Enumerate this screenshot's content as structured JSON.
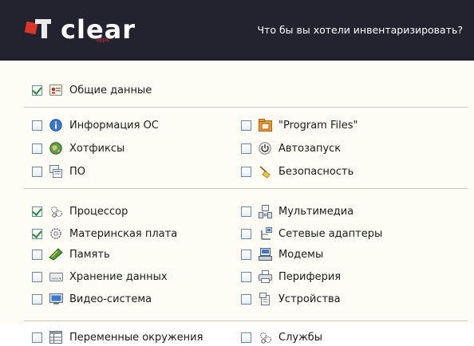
{
  "header": {
    "logo_text": "clear",
    "logo_sub": "apps",
    "question": "Что бы вы хотели инвентаризировать?"
  },
  "colors": {
    "header_bg": "#22232f",
    "accent_red": "#d8362b",
    "check_green": "#2f8a2f",
    "panel_bg": "#fdfdf6"
  },
  "groups": {
    "general": [
      {
        "label": "Общие данные",
        "checked": true,
        "icon": "id-card-icon"
      }
    ],
    "os": [
      {
        "label": "Информация ОС",
        "checked": false,
        "icon": "info-icon"
      },
      {
        "label": "Хотфиксы",
        "checked": false,
        "icon": "globe-icon"
      },
      {
        "label": "ПО",
        "checked": false,
        "icon": "software-icon"
      },
      {
        "label": "\"Program Files\"",
        "checked": false,
        "icon": "folder-icon"
      },
      {
        "label": "Автозапуск",
        "checked": false,
        "icon": "power-icon"
      },
      {
        "label": "Безопасность",
        "checked": false,
        "icon": "broom-icon"
      }
    ],
    "hardware": [
      {
        "label": "Процессор",
        "checked": true,
        "icon": "cpu-icon"
      },
      {
        "label": "Материнская плата",
        "checked": true,
        "icon": "gear-icon"
      },
      {
        "label": "Память",
        "checked": false,
        "icon": "memory-icon"
      },
      {
        "label": "Хранение данных",
        "checked": false,
        "icon": "drive-icon"
      },
      {
        "label": "Видео-система",
        "checked": false,
        "icon": "monitor-icon"
      },
      {
        "label": "Мультимедиа",
        "checked": false,
        "icon": "multimedia-icon"
      },
      {
        "label": "Сетевые адаптеры",
        "checked": false,
        "icon": "network-icon"
      },
      {
        "label": "Модемы",
        "checked": false,
        "icon": "modem-icon"
      },
      {
        "label": "Периферия",
        "checked": false,
        "icon": "printer-icon"
      },
      {
        "label": "Устройства",
        "checked": false,
        "icon": "device-icon"
      }
    ],
    "system": [
      {
        "label": "Переменные окружения",
        "checked": false,
        "icon": "env-table-icon"
      },
      {
        "label": "Службы",
        "checked": false,
        "icon": "services-icon"
      }
    ]
  }
}
